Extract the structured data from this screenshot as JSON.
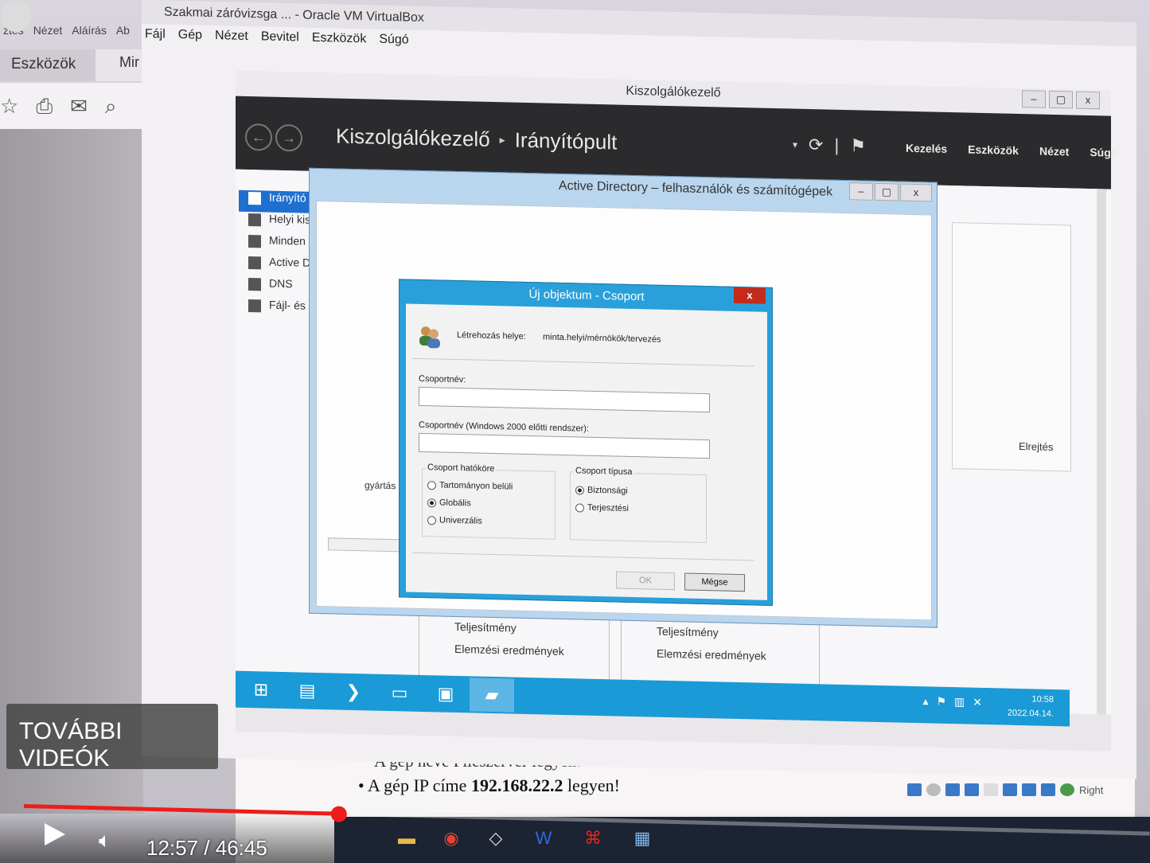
{
  "host": {
    "menu": [
      "ztés",
      "Nézet",
      "Aláírás",
      "Ab"
    ],
    "tab_tools": "Eszközök",
    "tab_mir": "Mir",
    "toolbar_icons": [
      "star-icon",
      "print-icon",
      "mail-icon",
      "zoom-icon"
    ],
    "doc_bullet1": "A gép neve Fileszerver legyen!",
    "doc_bullet2_prefix": "A gép IP címe ",
    "doc_bullet2_ip": "192.168.22.2",
    "doc_bullet2_suffix": " legyen!"
  },
  "vbox": {
    "title": "Szakmai záróvizsga ... - Oracle VM VirtualBox",
    "menu": [
      "Fájl",
      "Gép",
      "Nézet",
      "Bevitel",
      "Eszközök",
      "Súgó"
    ],
    "host_key": "Right"
  },
  "server_manager": {
    "title": "Kiszolgálókezelő",
    "breadcrumb_root": "Kiszolgálókezelő",
    "breadcrumb_page": "Irányítópult",
    "menu": [
      "Kezelés",
      "Eszközök",
      "Nézet",
      "Súgó"
    ],
    "nav": [
      {
        "label": "Irányító",
        "active": true
      },
      {
        "label": "Helyi kis",
        "active": false
      },
      {
        "label": "Minden",
        "active": false
      },
      {
        "label": "Active D",
        "active": false
      },
      {
        "label": "DNS",
        "active": false
      },
      {
        "label": "Fájl- és",
        "active": false
      }
    ],
    "tile_a": [
      "Teljesítmény",
      "Elemzési eredmények"
    ],
    "tile_b": [
      "Teljesítmény",
      "Elemzési eredmények"
    ],
    "hide_label": "Elrejtés",
    "window_controls": [
      "–",
      "▢",
      "x"
    ]
  },
  "ad_window": {
    "title": "Active Directory – felhasználók és számítógépek",
    "tree_item": "gyártás",
    "controls": [
      "–",
      "▢",
      "x"
    ]
  },
  "dialog": {
    "title": "Új objektum - Csoport",
    "close_label": "x",
    "location_label": "Létrehozás helye:",
    "location_value": "minta.helyi/mérnökök/tervezés",
    "group_name_label": "Csoportnév:",
    "group_name_value": "",
    "group_name_pre2000_label": "Csoportnév (Windows 2000 előtti rendszer):",
    "group_name_pre2000_value": "",
    "scope_title": "Csoport hatóköre",
    "scope_options": [
      {
        "label": "Tartományon belüli",
        "checked": false
      },
      {
        "label": "Globális",
        "checked": true
      },
      {
        "label": "Univerzális",
        "checked": false
      }
    ],
    "type_title": "Csoport típusa",
    "type_options": [
      {
        "label": "Biztonsági",
        "checked": true
      },
      {
        "label": "Terjesztési",
        "checked": false
      }
    ],
    "ok_label": "OK",
    "cancel_label": "Mégse"
  },
  "guest_taskbar": {
    "time": "10:58",
    "date": "2022.04.14."
  },
  "player": {
    "more_videos": "TOVÁBBI VIDEÓK",
    "time_display": "12:57 / 46:45",
    "progress": 0.28,
    "accent": "#ee1c1c"
  }
}
